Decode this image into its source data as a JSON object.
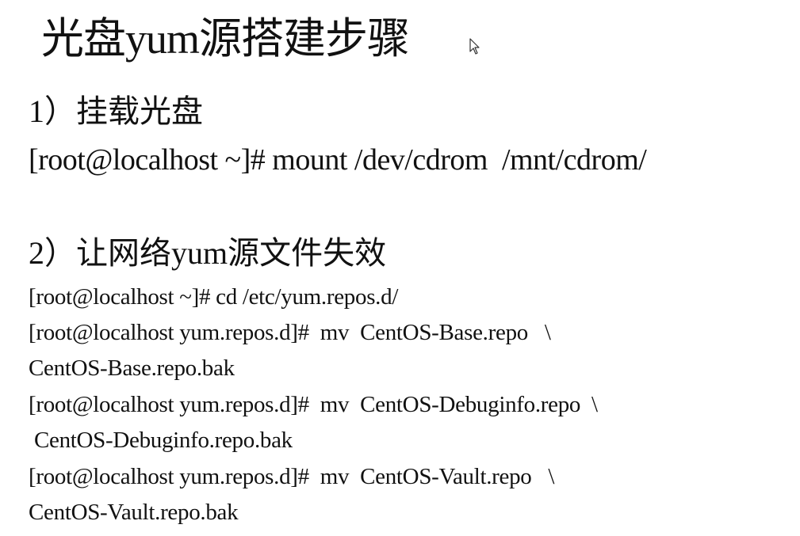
{
  "title": "光盘yum源搭建步骤",
  "step1": {
    "heading": "1）挂载光盘",
    "command": "[root@localhost ~]# mount /dev/cdrom  /mnt/cdrom/"
  },
  "step2": {
    "heading": "2）让网络yum源文件失效",
    "lines": [
      "[root@localhost ~]# cd /etc/yum.repos.d/",
      "[root@localhost yum.repos.d]#  mv  CentOS-Base.repo   \\",
      "CentOS-Base.repo.bak",
      "[root@localhost yum.repos.d]#  mv  CentOS-Debuginfo.repo  \\",
      " CentOS-Debuginfo.repo.bak",
      "[root@localhost yum.repos.d]#  mv  CentOS-Vault.repo   \\",
      "CentOS-Vault.repo.bak"
    ]
  },
  "icons": {
    "cursor": "mouse-pointer-icon"
  }
}
